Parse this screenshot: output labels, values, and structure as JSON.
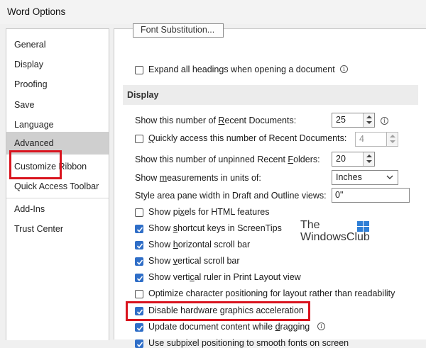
{
  "window": {
    "title": "Word Options"
  },
  "nav": {
    "items": [
      {
        "label": "General"
      },
      {
        "label": "Display"
      },
      {
        "label": "Proofing"
      },
      {
        "label": "Save"
      },
      {
        "label": "Language"
      },
      {
        "label": "Advanced",
        "selected": true
      },
      {
        "label": "Customize Ribbon"
      },
      {
        "label": "Quick Access Toolbar"
      },
      {
        "label": "Add-Ins"
      },
      {
        "label": "Trust Center"
      }
    ]
  },
  "content": {
    "cut_button_label": "Font Substitution...",
    "expand_headings": {
      "label": "Expand all headings when opening a document",
      "checked": false
    },
    "display_section": {
      "title": "Display"
    },
    "recent_docs": {
      "label_pre": "Show this number of ",
      "label_ul": "R",
      "label_post": "ecent Documents:",
      "value": "25"
    },
    "quick_access": {
      "label_pre": "",
      "label_ul": "Q",
      "label_post": "uickly access this number of Recent Documents:",
      "value": "4",
      "checked": false
    },
    "unpinned_folders": {
      "label_pre": "Show this number of unpinned Recent ",
      "label_ul": "F",
      "label_post": "olders:",
      "value": "20"
    },
    "measurements": {
      "label_pre": "Show ",
      "label_ul": "m",
      "label_post": "easurements in units of:",
      "value": "Inches"
    },
    "style_area": {
      "label": "Style area pane width in Draft and Outline views:",
      "value": "0\""
    },
    "checkboxes": [
      {
        "label_pre": "Show pi",
        "label_ul": "x",
        "label_post": "els for HTML features",
        "checked": false
      },
      {
        "label_pre": "Show ",
        "label_ul": "s",
        "label_post": "hortcut keys in ScreenTips",
        "checked": true
      },
      {
        "label_pre": "Show ",
        "label_ul": "h",
        "label_post": "orizontal scroll bar",
        "checked": true
      },
      {
        "label_pre": "Show ",
        "label_ul": "v",
        "label_post": "ertical scroll bar",
        "checked": true
      },
      {
        "label_pre": "Show verti",
        "label_ul": "c",
        "label_post": "al ruler in Print Layout view",
        "checked": true
      },
      {
        "label_pre": "Optimize character positioning for layout rather than readability",
        "label_ul": "",
        "label_post": "",
        "checked": false
      },
      {
        "label_pre": "Disable hardware graphics acceleration",
        "label_ul": "",
        "label_post": "",
        "checked": true
      },
      {
        "label_pre": "Update document content while ",
        "label_ul": "d",
        "label_post": "ragging",
        "checked": true
      },
      {
        "label_pre": "Use subpixel positioning to smooth fonts on screen",
        "label_ul": "",
        "label_post": "",
        "checked": true
      }
    ]
  },
  "watermark": {
    "line1": "The",
    "line2": "WindowsClub"
  },
  "colors": {
    "highlight": "#d9141e",
    "checkbox_checked": "#2f6ec7",
    "nav_selected": "#cfcfcf"
  }
}
